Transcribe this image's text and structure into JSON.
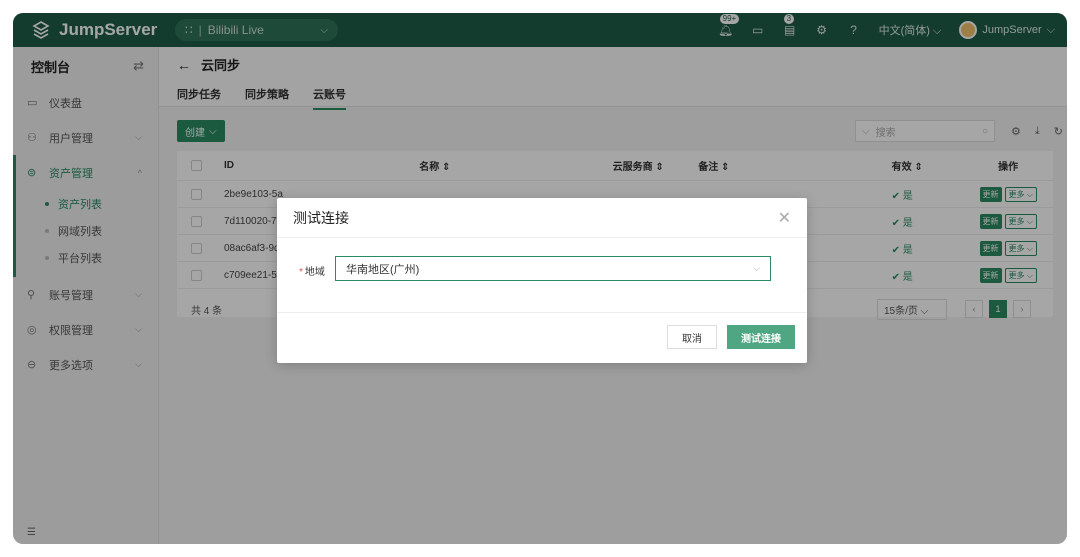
{
  "topbar": {
    "logo_text": "JumpServer",
    "org": "Bilibili Live",
    "org_prefix": "∷",
    "badge_notifications": "99+",
    "badge_tasks": "3",
    "language": "中文(简体)",
    "user": "JumpServer"
  },
  "sidebar": {
    "title": "控制台",
    "items": [
      {
        "icon": "dashboard-icon",
        "label": "仪表盘"
      },
      {
        "icon": "users-icon",
        "label": "用户管理"
      },
      {
        "icon": "assets-icon",
        "label": "资产管理"
      },
      {
        "icon": "accounts-icon",
        "label": "账号管理"
      },
      {
        "icon": "permissions-icon",
        "label": "权限管理"
      },
      {
        "icon": "more-icon",
        "label": "更多选项"
      }
    ],
    "sub_items": [
      "资产列表",
      "网域列表",
      "平台列表"
    ],
    "footer_icon": "menu-icon"
  },
  "page": {
    "title": "云同步",
    "tabs": [
      "同步任务",
      "同步策略",
      "云账号"
    ],
    "active_tab": "云账号"
  },
  "toolbar": {
    "create_label": "创建",
    "search_placeholder": "搜索"
  },
  "table": {
    "headers": {
      "id": "ID",
      "name": "名称",
      "provider": "云服务商",
      "note": "备注",
      "valid": "有效",
      "actions": "操作"
    },
    "rows": [
      {
        "id": "2be9e103-5a",
        "valid": "是"
      },
      {
        "id": "7d110020-7c",
        "valid": "是"
      },
      {
        "id": "08ac6af3-9d",
        "valid": "是"
      },
      {
        "id": "c709ee21-5f",
        "valid": "是"
      }
    ],
    "update_label": "更新",
    "more_label": "更多",
    "total": "共 4 条",
    "page_size": "15条/页",
    "current_page": "1"
  },
  "dialog": {
    "title": "测试连接",
    "field_label": "地域",
    "field_value": "华南地区(广州)",
    "cancel_label": "取消",
    "confirm_label": "测试连接"
  }
}
